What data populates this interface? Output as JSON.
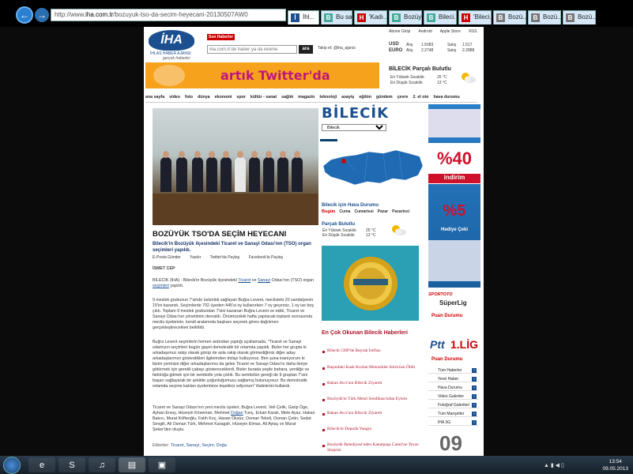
{
  "browser": {
    "url_prefix": "http://www.",
    "url_host": "iha.com.tr",
    "url_path": "/bozuyuk-tso-da-secim-heyecani-20130507AW0",
    "tabs": [
      {
        "label": "İhl...",
        "icon": "İ"
      },
      {
        "label": "Bu sa...",
        "icon": "B"
      },
      {
        "label": "'Kadı...",
        "icon": "H"
      },
      {
        "label": "Bozüy...",
        "icon": "B"
      },
      {
        "label": "Bileci...",
        "icon": "B"
      },
      {
        "label": "'Bileci...",
        "icon": "H"
      },
      {
        "label": "Bozü...",
        "icon": "B"
      },
      {
        "label": "Bozü...",
        "icon": "B"
      },
      {
        "label": "Bozü...",
        "icon": "B"
      }
    ]
  },
  "header": {
    "logo_text": "İHA",
    "logo_sub": "İHLAS HABER AJANSI",
    "logo_tag": "gerçek haberler",
    "son_haber": "Son Haberler",
    "search_placeholder": "iha.com.tr'de haber ya da kelime",
    "search_button": "ara",
    "takip": "Takip et: @iha_ajansi",
    "top_links": [
      "Abone Girişi",
      "Android",
      "Apple Store",
      "RSS"
    ],
    "currency": [
      {
        "name": "USD",
        "alis_label": "Alış",
        "alis": "1.5083",
        "satis_label": "Satış",
        "satis": "1.517"
      },
      {
        "name": "EURO",
        "alis_label": "Alış",
        "alis": "2.2748",
        "satis_label": "Satış",
        "satis": "2.2888"
      }
    ]
  },
  "banner": {
    "text": "artık Twitter'da"
  },
  "weather_top": {
    "title": "BİLECİK Parçalı Bulutlu",
    "max_label": "En Yüksek Sıcaklık",
    "max_value": "25 °C",
    "min_label": "En Düşük Sıcaklık",
    "min_value": "13 °C"
  },
  "menu": [
    "ana sayfa",
    "video",
    "foto",
    "dünya",
    "ekonomi",
    "spor",
    "kültür - sanat",
    "sağlık",
    "magazin",
    "teknoloji",
    "asayiş",
    "eğitim",
    "gündem",
    "çevre",
    "2. el oto",
    "hava durumu"
  ],
  "article": {
    "title": "BOZÜYÜK TSO'DA SEÇİM HEYECANI",
    "lead": "Bilecik'in Bozüyük ilçesindeki Ticaret ve Sanayi Odası'nın (TSO) organ seçimleri yapıldı.",
    "share": [
      "E-Posta Gönder",
      "Yazdır",
      "Twitter'da Paylaş",
      "Facebook'ta Paylaş"
    ],
    "author": "İSMET CEP",
    "p1_a": "BİLECİK (İHA) - Bilecik'in Bozüyük ilçesindeki ",
    "p1_l1": "Ticaret",
    "p1_b": " ve ",
    "p1_l2": "Sanayi",
    "p1_c": " Odası'nın (TSO) organ ",
    "p1_l3": "seçimleri",
    "p1_d": " yapıldı.",
    "p2": "9 meslek grubunun 7'sinde üstünlük sağlayan Buğra Levent, meclisteki 20 sandalyenin 15'ini kazandı. Seçimlerde 702 üyeden 445'si oy kullanırken 7 oy geçersiz, 1 oy ise boş çıktı. Toplam 9 meslek grubundan 7'sini kazanan Buğra Levent ve ekibi, Ticaret ve Sanayi Odası'nın yönetimini devraldı. Önümüzdeki hafta yapılacak toplantı sonrasında meclis üyelerinin, kendi aralarında başkanı seçerek görev dağılımını gerçekleştirecekleri belirtildi.",
    "p3": "Buğra Levent seçimlerin hemen ardından yaptığı açıklamada, \"Ticaret ve Sanayi odamızın seçimleri bugün gayet demokratik bir ortamda yapıldı. Bizler her grupta ki arkadaşımızı rakip olarak görüp de asla rakip olarak görmediğimiz diğer aday arkadaşlarımızı gösterdikleri ilgilerinden dolayı kutluyoruz. Ben şuna inanıyorum ki bizim yerimize diğer arkadaşlarımız da gelse Ticaret ve Sanayi Odası'nı daha ileriye götürmek için gerekli çabayı göstereceklerdi. Bizler burada yeşile bahara, yeniliğe ve farklılığa gitmek için bir sembolle yola çıktık. Bu sembolün gereği de 9 gruptan 7'sini başarı sağlayarak bir şekilde çoğunluğumuzu sağlamış bulunuyoruz. Bu demokratik ortamda seçime katılan üyelerimize teşekkür ediyorum\" ifadelerini kullandı.",
    "p4_a": "Ticaret ve Sanayi Odası'nın yeni meclis üyeleri, Buğra Levent, Veli Çelik, Garip Öge, Ayhan Ersoy, Hüseyin Köseman, Mehmet ",
    "p4_l": "Doğan",
    "p4_b": " Tunç, Erkan Karalı, Mete Ayaz, Hakan Bakıcı, Murat Köfteoğlu, Fatih Koç, Hasan Öksüz, Osman Tekeli, Osman Çetin, Sedat Sevgili, Ali Osman Türk, Mehmet Karagah, Hüseyin Elmas, Ali Aytaç ve Murat Şeker'den oluştu.",
    "etiket_label": "Etiketler:",
    "etiket": "Ticaret, Sanayi, Seçim, Doğa"
  },
  "city": {
    "title": "BİLECİK",
    "select": "Bilecik",
    "hava_title": "Bilecik için Hava Durumu",
    "bugun": "Bugün",
    "days": [
      "Cuma",
      "Cumartesi",
      "Pazar",
      "Pazartesi"
    ],
    "condition": "Parçalı Bulutlu",
    "max_label": "En Yüksek Sıcaklık",
    "max_value": "25 °C",
    "min_label": "En Düşük Sıcaklık",
    "min_value": "13 °C"
  },
  "most_read": {
    "title": "En Çok Okunan Bilecik Haberleri",
    "items": [
      "Bilecik CHP'de Bayrak İstifası",
      "Başındaki Kask Kırılan Motosiklet Sürücüsü Öldü",
      "Bakan Avcı'nın Bilecik Ziyareti",
      "Bozüyük'te Türk Metal Sendikası'ndan Eylem",
      "Bakan Avcı'nın Bilecik Ziyareti",
      "Bilecik'te Depoda Yangın",
      "Bozüyük Belediyesi'nden Kanatpaşa Camii'ne Teyze Sürprizi"
    ]
  },
  "sidebar": {
    "ad_percent": "%40",
    "ad_indirim": "indirim",
    "ad_plus": "%5",
    "ad_hediye": "Hediye Çeki",
    "spor_title": "SüperLig",
    "spor_brand": "SPORTOTO",
    "puan1": "Puan Durumu",
    "ptt_title": "1.LİG",
    "ptt_brand": "Ptt",
    "puan2": "Puan Durumu",
    "buttons": [
      {
        "label": "Tüm Haberler",
        "n": "+"
      },
      {
        "label": "Yerel Haber",
        "n": "+"
      },
      {
        "label": "Hava Durumu",
        "n": "+"
      },
      {
        "label": "Video Galeriler",
        "n": "+"
      },
      {
        "label": "Fotoğraf Galerileri",
        "n": "+"
      },
      {
        "label": "Tüm Manşetler",
        "n": "+"
      },
      {
        "label": "İHA 3G",
        "n": "+"
      }
    ],
    "big_number": "09"
  },
  "taskbar": {
    "time": "13:54",
    "date": "09.05.2013",
    "tray": "▲ ▮ ◀ ▯"
  }
}
